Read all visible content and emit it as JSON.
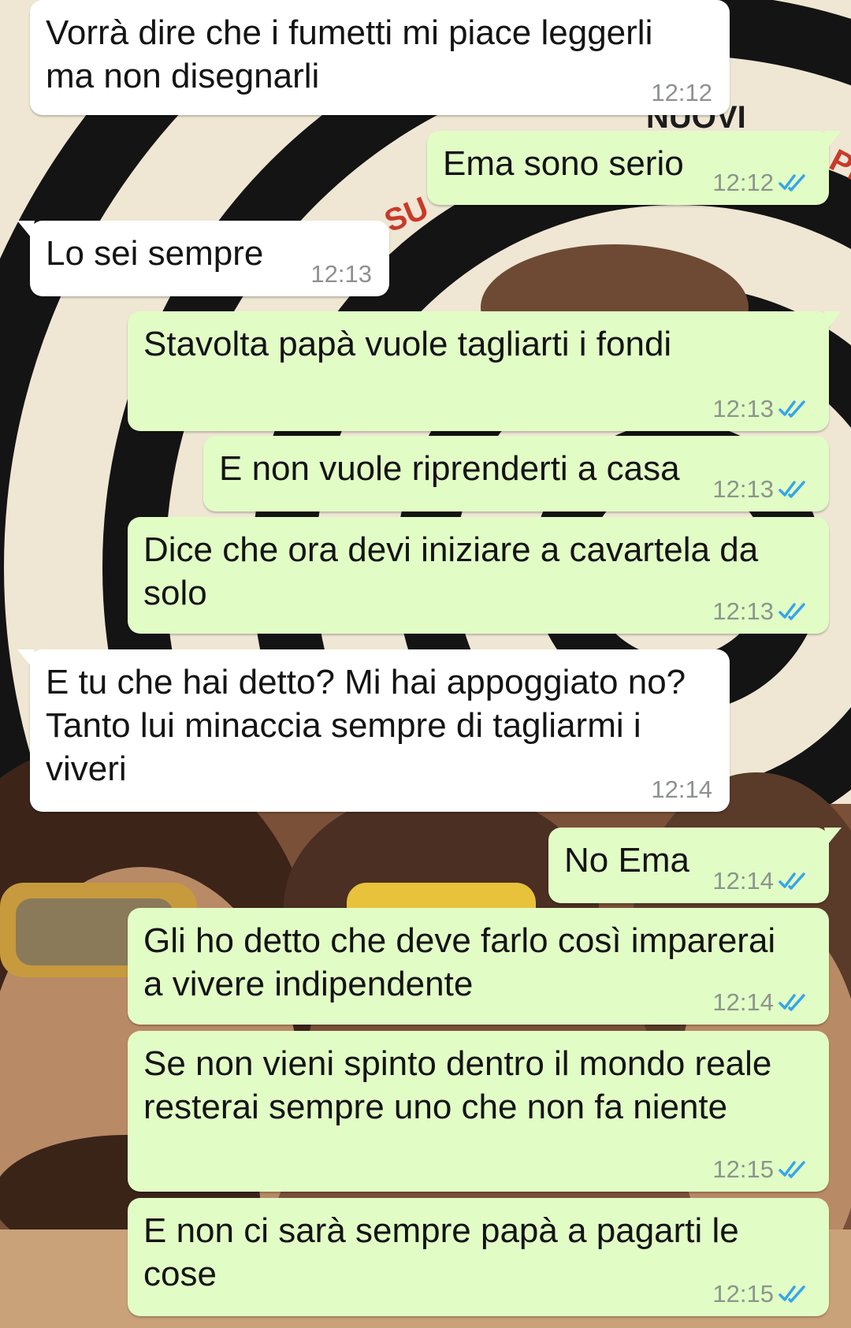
{
  "messages": [
    {
      "dir": "in",
      "lines": [
        "Vorrà dire che i fumetti mi piace leggerli",
        "ma non disegnarli"
      ],
      "time": "12:12"
    },
    {
      "dir": "out",
      "lines": [
        "Ema sono serio"
      ],
      "time": "12:12",
      "read": true
    },
    {
      "dir": "in",
      "lines": [
        "Lo sei sempre"
      ],
      "time": "12:13"
    },
    {
      "dir": "out",
      "lines": [
        "Stavolta papà vuole tagliarti i fondi"
      ],
      "time": "12:13",
      "read": true
    },
    {
      "dir": "out",
      "lines": [
        "E non vuole riprenderti a casa"
      ],
      "time": "12:13",
      "read": true
    },
    {
      "dir": "out",
      "lines": [
        "Dice che ora devi iniziare a cavartela da",
        "solo"
      ],
      "time": "12:13",
      "read": true
    },
    {
      "dir": "in",
      "lines": [
        "E tu che hai detto? Mi hai appoggiato no?",
        "Tanto lui minaccia sempre di tagliarmi i",
        "viveri"
      ],
      "time": "12:14"
    },
    {
      "dir": "out",
      "lines": [
        "No Ema"
      ],
      "time": "12:14",
      "read": true
    },
    {
      "dir": "out",
      "lines": [
        "Gli ho detto che deve farlo così imparerai",
        "a vivere indipendente"
      ],
      "time": "12:14",
      "read": true
    },
    {
      "dir": "out",
      "lines": [
        "Se non vieni spinto dentro il mondo reale",
        "resterai sempre uno che non fa niente"
      ],
      "time": "12:15",
      "read": true
    },
    {
      "dir": "out",
      "lines": [
        "E non ci sarà sempre papà a pagarti le",
        "cose"
      ],
      "time": "12:15",
      "read": true
    }
  ],
  "wallpaper": {
    "poster_text": [
      "SU",
      "NUOVI",
      "PE"
    ],
    "colors": {
      "cream": "#efe6d4",
      "ring": "#141414",
      "skin": "#b98a66",
      "hair": "#4a2f22",
      "lens": "#e8c23a"
    }
  },
  "colors": {
    "incoming_bubble": "#ffffff",
    "outgoing_bubble": "#e2fcc6",
    "read_tick": "#34a6e8",
    "timestamp": "#8a968c"
  },
  "icons": {
    "read_receipt": "double-check-icon"
  }
}
